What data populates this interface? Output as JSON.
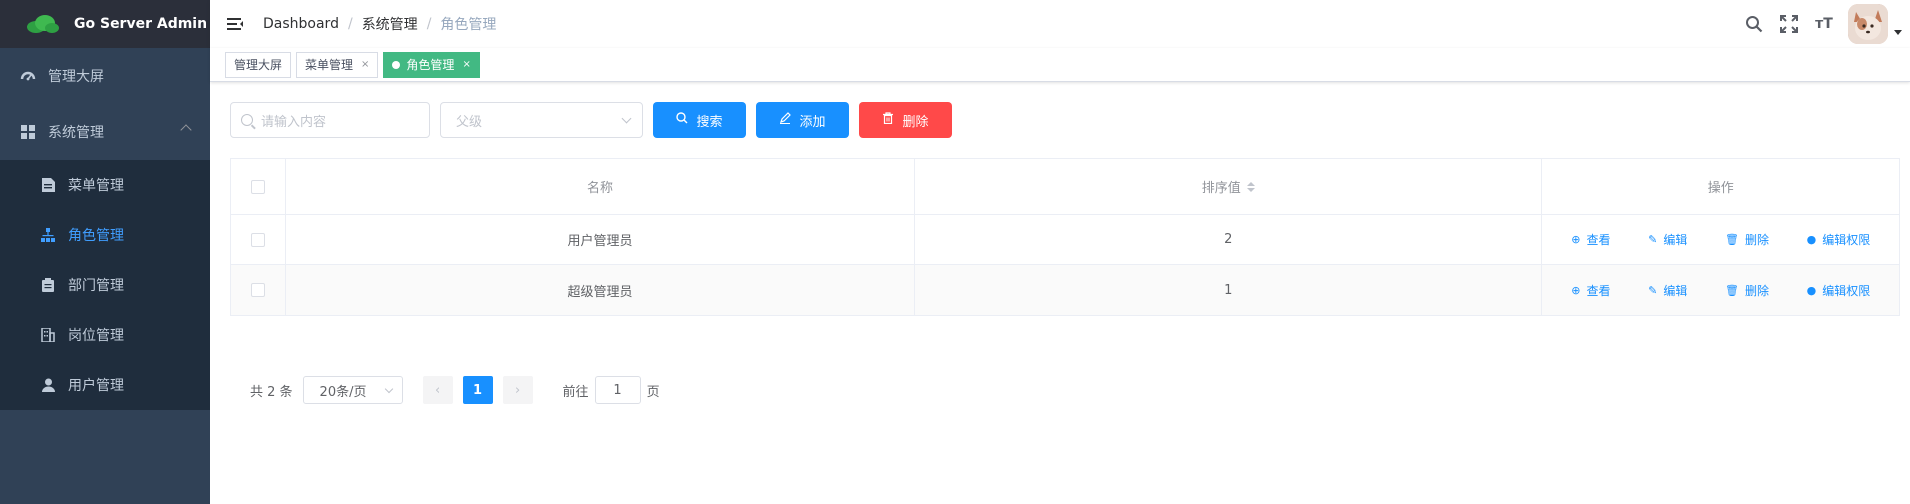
{
  "app": {
    "title": "Go Server Admin"
  },
  "sidebar": {
    "items": [
      {
        "label": "管理大屏",
        "icon": "dashboard-icon"
      },
      {
        "label": "系统管理",
        "icon": "grid-icon",
        "expanded": true,
        "children": [
          {
            "label": "菜单管理",
            "icon": "document-icon"
          },
          {
            "label": "角色管理",
            "icon": "sitemap-icon",
            "active": true
          },
          {
            "label": "部门管理",
            "icon": "clipboard-icon"
          },
          {
            "label": "岗位管理",
            "icon": "building-icon"
          },
          {
            "label": "用户管理",
            "icon": "user-icon"
          }
        ]
      }
    ]
  },
  "navbar": {
    "breadcrumb": [
      "Dashboard",
      "系统管理",
      "角色管理"
    ],
    "separator": "/",
    "font_size_label": "тT"
  },
  "tags": [
    {
      "label": "管理大屏",
      "closable": false
    },
    {
      "label": "菜单管理",
      "closable": true
    },
    {
      "label": "角色管理",
      "closable": true,
      "active": true
    }
  ],
  "tag_close": "×",
  "toolbar": {
    "search_placeholder": "请输入内容",
    "parent_select_placeholder": "父级",
    "search_label": "搜索",
    "add_label": "添加",
    "delete_label": "删除"
  },
  "table": {
    "columns": [
      "名称",
      "排序值",
      "操作"
    ],
    "rows": [
      {
        "name": "用户管理员",
        "sort": "2"
      },
      {
        "name": "超级管理员",
        "sort": "1"
      }
    ],
    "actions": [
      "查看",
      "编辑",
      "删除",
      "编辑权限"
    ]
  },
  "pagination": {
    "total_text": "共 2 条",
    "page_size": "20条/页",
    "current_page": "1",
    "goto_prefix": "前往",
    "goto_value": "1",
    "goto_suffix": "页"
  },
  "colors": {
    "sidebar_bg": "#304156",
    "submenu_bg": "#1f2d3d",
    "primary": "#1890ff",
    "danger": "#ff4949",
    "tag_active": "#42b983"
  }
}
